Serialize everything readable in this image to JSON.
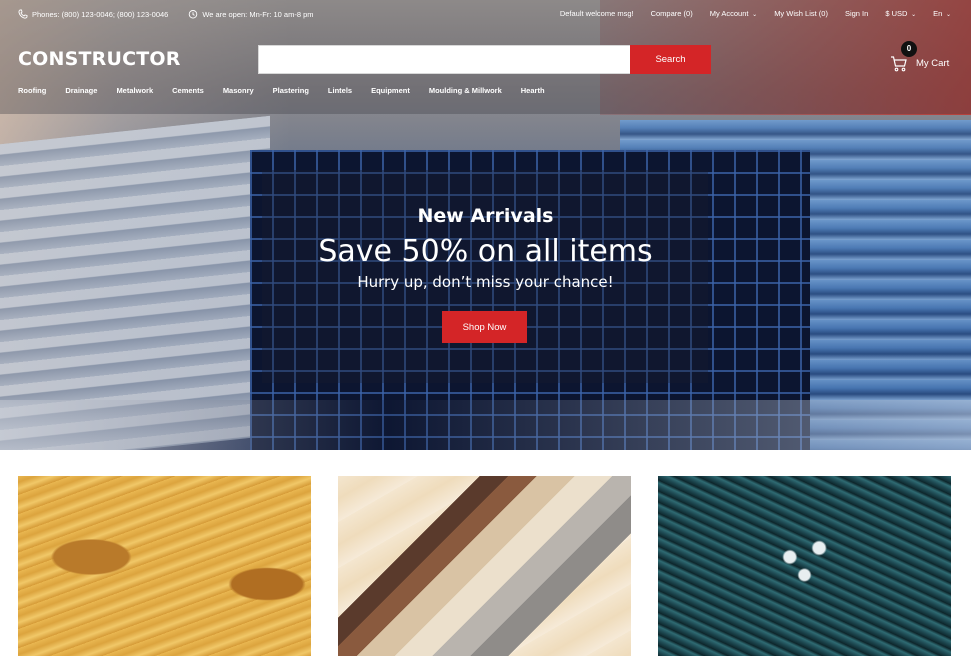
{
  "topbar": {
    "phones": "Phones: (800) 123-0046; (800) 123-0046",
    "hours": "We are open: Mn-Fr: 10 am-8 pm",
    "welcome": "Default welcome msg!",
    "compare": "Compare (0)",
    "account": "My Account",
    "wishlist": "My Wish List (0)",
    "signin": "Sign In",
    "currency": "$ USD",
    "language": "En"
  },
  "header": {
    "logo": "CONSTRUCTOR",
    "search": {
      "placeholder": "",
      "value": "",
      "button_label": "Search"
    },
    "cart": {
      "count": "0",
      "label": "My Cart"
    }
  },
  "nav": {
    "items": [
      {
        "label": "Roofing"
      },
      {
        "label": "Drainage"
      },
      {
        "label": "Metalwork"
      },
      {
        "label": "Cements"
      },
      {
        "label": "Masonry"
      },
      {
        "label": "Plastering"
      },
      {
        "label": "Lintels"
      },
      {
        "label": "Equipment"
      },
      {
        "label": "Moulding & Millwork"
      },
      {
        "label": "Hearth"
      }
    ]
  },
  "hero": {
    "kicker": "New Arrivals",
    "title": "Save 50% on all items",
    "subtitle": "Hurry up, don’t miss your chance!",
    "button_label": "Shop Now"
  },
  "categories": [
    {
      "image": "lumber-image"
    },
    {
      "image": "flooring-samples-image"
    },
    {
      "image": "rebar-image"
    }
  ],
  "colors": {
    "accent_red": "#d42527",
    "text_white": "#ffffff"
  }
}
